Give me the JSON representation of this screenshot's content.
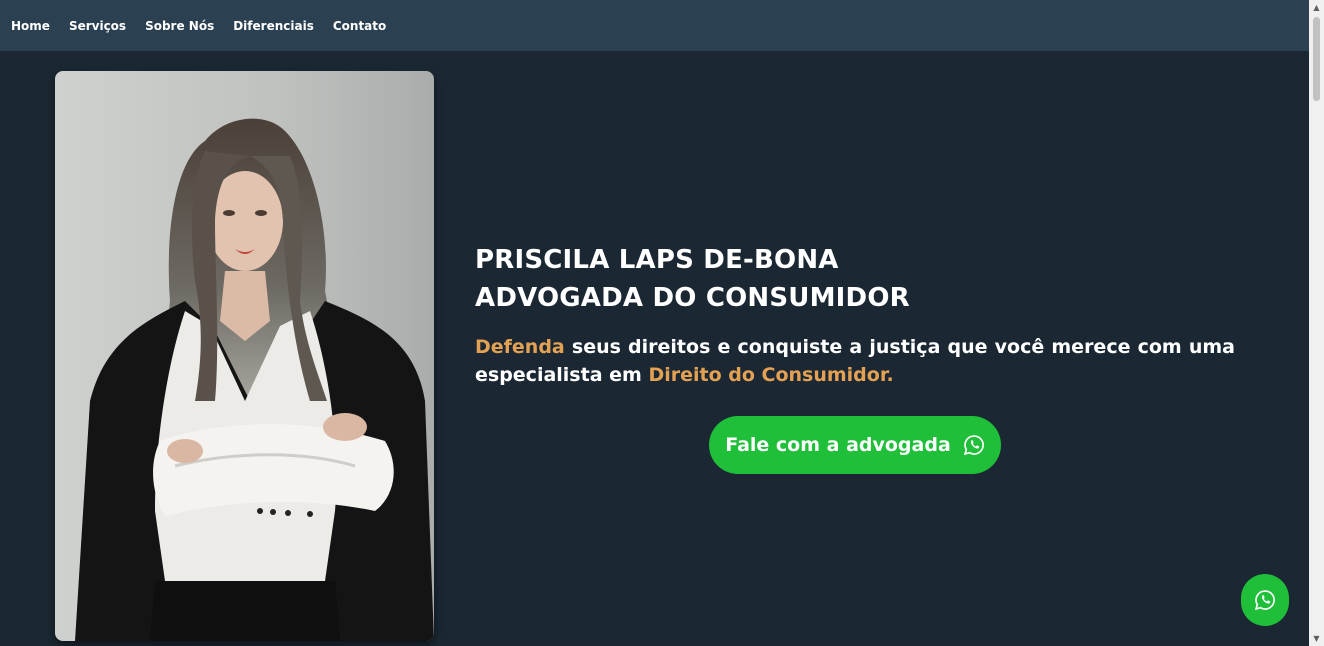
{
  "nav": {
    "items": [
      {
        "label": "Home"
      },
      {
        "label": "Serviços"
      },
      {
        "label": "Sobre Nós"
      },
      {
        "label": "Diferenciais"
      },
      {
        "label": "Contato"
      }
    ]
  },
  "hero": {
    "title_line1": "PRISCILA LAPS DE-BONA",
    "title_line2": "ADVOGADA DO CONSUMIDOR",
    "lead_accent1": "Defenda",
    "lead_text1": " seus direitos e conquiste a justiça que você merece com uma especialista em ",
    "lead_accent2": "Direito do Consumidor.",
    "cta_label": "Fale com a advogada",
    "cta_icon": "whatsapp-icon"
  },
  "floating_button": {
    "icon": "whatsapp-icon"
  },
  "colors": {
    "background": "#1b2833",
    "navbar": "#2b4152",
    "accent": "#e3a154",
    "whatsapp_green": "#1fbf3a"
  }
}
